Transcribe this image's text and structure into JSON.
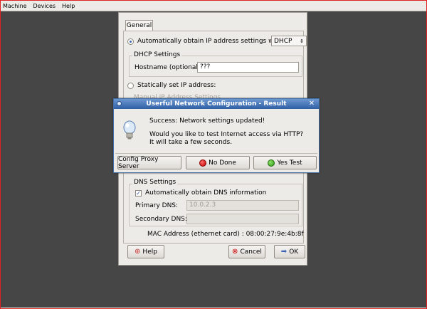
{
  "menubar": {
    "items": [
      "Machine",
      "Devices",
      "Help"
    ]
  },
  "config": {
    "tab_general": "General",
    "auto_ip_label": "Automatically obtain IP address settings with:",
    "auto_ip_mode": "DHCP",
    "dhcp_group_title": "DHCP Settings",
    "hostname_label": "Hostname (optional):",
    "hostname_value": "???",
    "static_label": "Statically set IP address:",
    "manual_group_title": "Manual IP Address Settings",
    "dns_group_title": "DNS Settings",
    "auto_dns_label": "Automatically obtain DNS information",
    "primary_dns_label": "Primary DNS:",
    "primary_dns_value": "10.0.2.3",
    "secondary_dns_label": "Secondary DNS:",
    "secondary_dns_value": "",
    "mac_text": "MAC Address (ethernet card) : 08:00:27:9e:4b:8f",
    "help_label": "Help",
    "cancel_label": "Cancel",
    "ok_label": "OK"
  },
  "dialog": {
    "title": "Userful Network Configuration - Result",
    "line1": "Success: Network settings updated!",
    "line2": "Would you like to test Internet access via HTTP?",
    "line3": "It will take a few seconds.",
    "proxy_label": "Config Proxy Server",
    "no_label": "No Done",
    "yes_label": "Yes Test"
  },
  "colors": {
    "titlebar": "#2f5fa5",
    "frame_border": "#dd2222",
    "desktop": "#464646"
  }
}
